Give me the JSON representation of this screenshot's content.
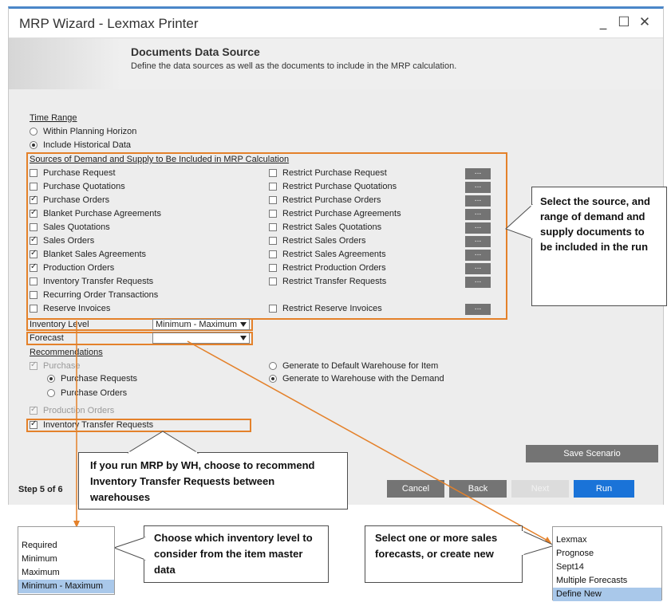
{
  "window": {
    "title": "MRP Wizard - Lexmax Printer",
    "minimize": "_",
    "maximize": "☐",
    "close": "✕"
  },
  "header": {
    "title": "Documents Data Source",
    "subtitle": "Define the data sources as well as the documents to include in the MRP calculation."
  },
  "time_range": {
    "label": "Time Range",
    "options": [
      {
        "label": "Within Planning Horizon",
        "selected": false
      },
      {
        "label": "Include Historical Data",
        "selected": true
      }
    ]
  },
  "sources": {
    "title": "Sources of Demand and Supply to Be Included in MRP Calculation",
    "left": [
      {
        "label": "Purchase Request",
        "checked": false
      },
      {
        "label": "Purchase Quotations",
        "checked": false
      },
      {
        "label": "Purchase Orders",
        "checked": true
      },
      {
        "label": "Blanket Purchase Agreements",
        "checked": true
      },
      {
        "label": "Sales Quotations",
        "checked": false
      },
      {
        "label": "Sales Orders",
        "checked": true
      },
      {
        "label": "Blanket Sales Agreements",
        "checked": true
      },
      {
        "label": "Production Orders",
        "checked": true
      },
      {
        "label": "Inventory Transfer Requests",
        "checked": false
      },
      {
        "label": "Recurring Order Transactions",
        "checked": false
      },
      {
        "label": "Reserve Invoices",
        "checked": false
      }
    ],
    "right": [
      {
        "label": "Restrict Purchase Request",
        "checked": false
      },
      {
        "label": "Restrict Purchase Quotations",
        "checked": false
      },
      {
        "label": "Restrict Purchase Orders",
        "checked": false
      },
      {
        "label": "Restrict Purchase Agreements",
        "checked": false
      },
      {
        "label": "Restrict Sales Quotations",
        "checked": false
      },
      {
        "label": "Restrict Sales Orders",
        "checked": false
      },
      {
        "label": "Restrict Sales Agreements",
        "checked": false
      },
      {
        "label": "Restrict Production Orders",
        "checked": false
      },
      {
        "label": "Restrict Transfer Requests",
        "checked": false
      },
      {
        "label": "Restrict Reserve Invoices",
        "checked": false
      }
    ],
    "browse_label": "..."
  },
  "inventory_level": {
    "label": "Inventory Level",
    "value": "Minimum - Maximum"
  },
  "forecast": {
    "label": "Forecast",
    "value": ""
  },
  "recommendations": {
    "label": "Recommendations",
    "purchase": "Purchase",
    "purchase_requests": "Purchase Requests",
    "purchase_orders": "Purchase Orders",
    "production_orders": "Production Orders",
    "inventory_transfer_requests": "Inventory Transfer Requests",
    "default_warehouse": "Generate to Default Warehouse for Item",
    "warehouse_demand": "Generate to Warehouse with the Demand"
  },
  "save_scenario": "Save Scenario",
  "step": "Step 5 of 6",
  "nav": {
    "cancel": "Cancel",
    "back": "Back",
    "next": "Next",
    "run": "Run"
  },
  "callouts": {
    "sources": "Select the source, and range of demand and supply documents to be included in the run",
    "transfer": "If you run MRP by WH, choose to recommend Inventory Transfer Requests between warehouses",
    "inventory": "Choose which inventory level to consider from the item master data",
    "forecast": "Select one or more sales forecasts, or create new"
  },
  "inventory_popup": [
    "Required",
    "Minimum",
    "Maximum",
    "Minimum - Maximum"
  ],
  "forecast_popup": [
    "Lexmax",
    "Prognose",
    "Sept14",
    "Multiple Forecasts",
    "Define New"
  ],
  "colors": {
    "accent_orange": "#e4812a",
    "run_button": "#1a73d8",
    "window_border": "#4a86c8",
    "popup_highlight": "#a9c8ea"
  }
}
